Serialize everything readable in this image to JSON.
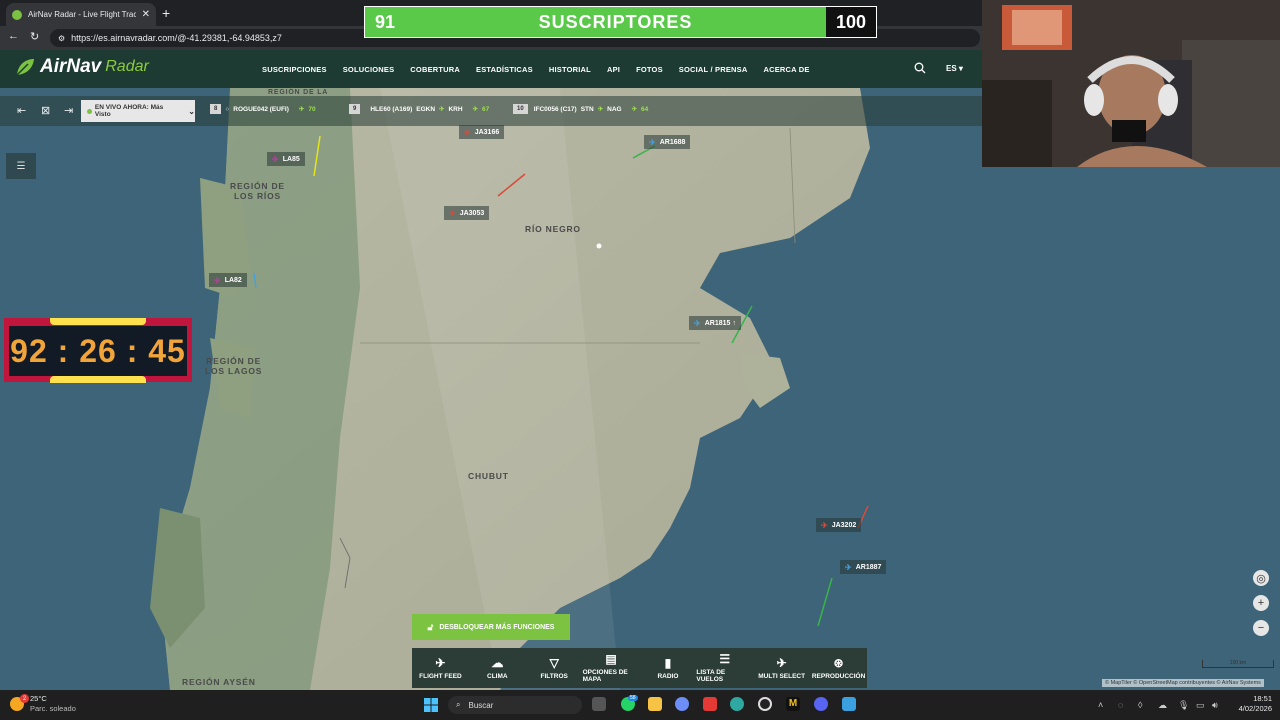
{
  "browser": {
    "tab_title": "AirNav Radar - Live Flight Tracker",
    "tab_close": "✕",
    "new_tab": "+",
    "url": "https://es.airnavradar.com/@-41.29381,-64.94853,z7"
  },
  "subscribers": {
    "current": "91",
    "label": "SUSCRIPTORES",
    "goal": "100",
    "progress": 0.91
  },
  "site": {
    "logo_main": "AirNav",
    "logo_sub": "Radar",
    "nav": [
      "SUSCRIPCIONES",
      "SOLUCIONES",
      "COBERTURA",
      "ESTADÍSTICAS",
      "HISTORIAL",
      "API",
      "FOTOS",
      "SOCIAL / PRENSA",
      "ACERCA DE"
    ],
    "lang": "ES ▾"
  },
  "toolbar": {
    "live_select": "EN VIVO AHORA: Más Visto",
    "stats": [
      {
        "rank": "8",
        "flight": "ROGUE042 (EUFI)",
        "count": "70"
      },
      {
        "rank": "9",
        "flight": "HLE60 (A169)",
        "route_from": "EGKN",
        "route_to": "KRH",
        "count": "67"
      },
      {
        "rank": "10",
        "flight": "IFC0056 (C17)",
        "route_from": "STN",
        "route_to": "NAG",
        "count": "64"
      }
    ]
  },
  "map": {
    "regions": {
      "rios": "REGIÓN DE\nLOS RÍOS",
      "lagos": "REGIÓN DE\nLOS LAGOS",
      "aysen": "REGIÓN AYSÉN",
      "rionegro": "RÍO NEGRO",
      "chubut": "CHUBUT",
      "top": "REGIÓN DE LA"
    },
    "flights": {
      "ja3166": "JA3166",
      "ar1688": "AR1688",
      "la85": "LA85",
      "ja3053": "JA3053",
      "la82": "LA82",
      "ar1815": "AR1815 ↑",
      "ja3202": "JA3202",
      "ar1887": "AR1887"
    },
    "attribution": "© MapTiler © OpenStreetMap contribuyentes © AirNav Systems",
    "scale": "100 km"
  },
  "timer": {
    "value": "92 : 26 : 45"
  },
  "unlock_label": "DESBLOQUEAR MÁS FUNCIONES",
  "bottom_menu": [
    "FLIGHT FEED",
    "CLIMA",
    "FILTROS",
    "OPCIONES DE MAPA",
    "RADIO",
    "LISTA DE VUELOS",
    "MULTI SELECT",
    "REPRODUCCIÓN"
  ],
  "taskbar": {
    "temp": "25°C",
    "weather": "Parc. soleado",
    "search": "Buscar",
    "time": "18:51",
    "date": "4/02/2026",
    "badge": "2",
    "whatsapp_badge": "58"
  },
  "colors": {
    "airnav_green": "#7cc341",
    "header": "#1d3b32",
    "timer_border": "#c0163e",
    "timer_text": "#f0a43a"
  }
}
